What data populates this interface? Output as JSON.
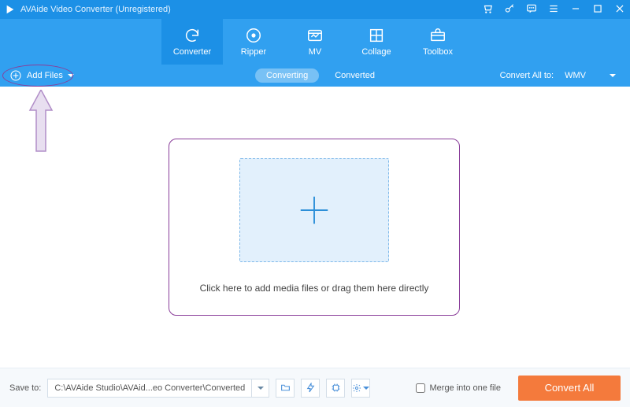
{
  "titlebar": {
    "title": "AVAide Video Converter (Unregistered)"
  },
  "nav": {
    "items": [
      {
        "label": "Converter"
      },
      {
        "label": "Ripper"
      },
      {
        "label": "MV"
      },
      {
        "label": "Collage"
      },
      {
        "label": "Toolbox"
      }
    ]
  },
  "subbar": {
    "add_files_label": "Add Files",
    "tab_converting": "Converting",
    "tab_converted": "Converted",
    "convert_all_label": "Convert All to:",
    "convert_all_value": "WMV"
  },
  "drop": {
    "instruction": "Click here to add media files or drag them here directly"
  },
  "footer": {
    "save_to_label": "Save to:",
    "save_to_path": "C:\\AVAide Studio\\AVAid...eo Converter\\Converted",
    "merge_label": "Merge into one file",
    "convert_btn": "Convert All"
  }
}
